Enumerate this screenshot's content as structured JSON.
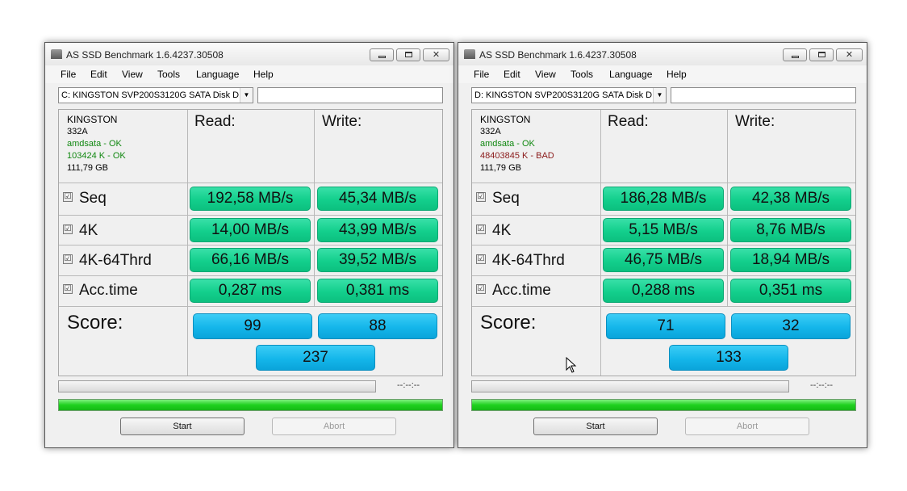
{
  "app": {
    "title": "AS SSD Benchmark 1.6.4237.30508",
    "menu": [
      "File",
      "Edit",
      "View",
      "Tools",
      "Language",
      "Help"
    ],
    "col_read": "Read:",
    "col_write": "Write:",
    "score_label": "Score:",
    "time": "--:--:--",
    "start": "Start",
    "abort": "Abort",
    "checkbox_glyph": "☑"
  },
  "windows": [
    {
      "drive": "C: KINGSTON  SVP200S3120G SATA Disk D",
      "info": {
        "name": "KINGSTON",
        "firmware": "332A",
        "driver": "amdsata - OK",
        "alignment": "103424 K - OK",
        "size": "111,79 GB"
      },
      "rows": [
        {
          "label": "Seq",
          "read": "192,58 MB/s",
          "write": "45,34 MB/s"
        },
        {
          "label": "4K",
          "read": "14,00 MB/s",
          "write": "43,99 MB/s"
        },
        {
          "label": "4K-64Thrd",
          "read": "66,16 MB/s",
          "write": "39,52 MB/s"
        },
        {
          "label": "Acc.time",
          "read": "0,287 ms",
          "write": "0,381 ms"
        }
      ],
      "score": {
        "read": "99",
        "write": "88",
        "total": "237"
      }
    },
    {
      "drive": "D: KINGSTON  SVP200S3120G SATA Disk D",
      "info": {
        "name": "KINGSTON",
        "firmware": "332A",
        "driver": "amdsata - OK",
        "alignment": "48403845 K - BAD",
        "size": "111,79 GB"
      },
      "rows": [
        {
          "label": "Seq",
          "read": "186,28 MB/s",
          "write": "42,38 MB/s"
        },
        {
          "label": "4K",
          "read": "5,15 MB/s",
          "write": "8,76 MB/s"
        },
        {
          "label": "4K-64Thrd",
          "read": "46,75 MB/s",
          "write": "18,94 MB/s"
        },
        {
          "label": "Acc.time",
          "read": "0,288 ms",
          "write": "0,351 ms"
        }
      ],
      "score": {
        "read": "71",
        "write": "32",
        "total": "133"
      }
    }
  ]
}
